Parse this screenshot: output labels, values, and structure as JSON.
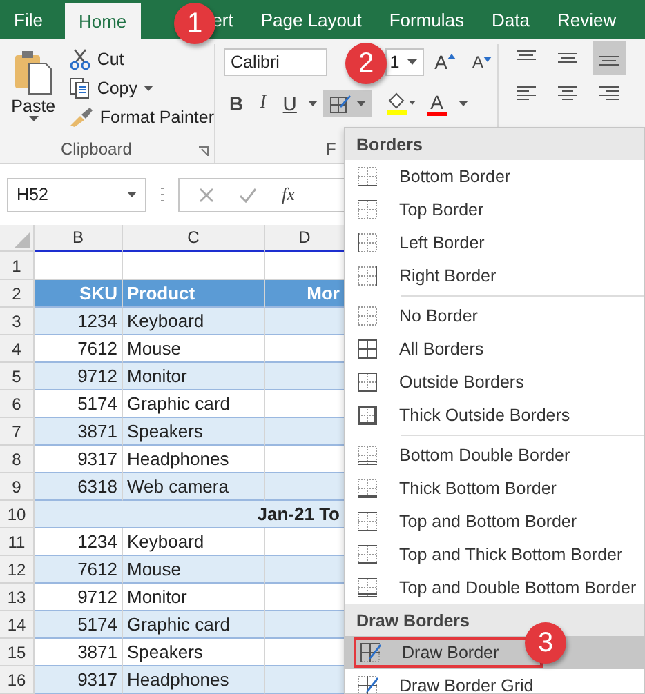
{
  "tabs": [
    {
      "label": "File",
      "selected": false
    },
    {
      "label": "Home",
      "selected": true
    },
    {
      "label": "ert",
      "selected": false
    },
    {
      "label": "Page Layout",
      "selected": false
    },
    {
      "label": "Formulas",
      "selected": false
    },
    {
      "label": "Data",
      "selected": false
    },
    {
      "label": "Review",
      "selected": false
    }
  ],
  "clipboard": {
    "paste": "Paste",
    "cut": "Cut",
    "copy": "Copy",
    "format_painter": "Format Painter",
    "group_label": "Clipboard"
  },
  "font": {
    "font_name": "Calibri",
    "font_size": "1",
    "grow": "A",
    "shrink": "A",
    "bold": "B",
    "italic": "I",
    "underline": "U",
    "font_color_letter": "A",
    "group_label": "F",
    "border_button_pressed": true
  },
  "formula_bar": {
    "name_box": "H52",
    "function_label": "fx"
  },
  "sheet": {
    "columns": [
      "B",
      "C",
      "D"
    ],
    "rows": [
      {
        "number": "1",
        "kind": "empty"
      },
      {
        "number": "2",
        "kind": "header",
        "cells": [
          "SKU",
          "Product",
          "Mor"
        ]
      },
      {
        "number": "3",
        "kind": "band",
        "cells": [
          "1234",
          "Keyboard"
        ]
      },
      {
        "number": "4",
        "kind": "plain",
        "cells": [
          "7612",
          "Mouse"
        ]
      },
      {
        "number": "5",
        "kind": "band",
        "cells": [
          "9712",
          "Monitor"
        ]
      },
      {
        "number": "6",
        "kind": "plain",
        "cells": [
          "5174",
          "Graphic card"
        ]
      },
      {
        "number": "7",
        "kind": "band",
        "cells": [
          "3871",
          "Speakers"
        ]
      },
      {
        "number": "8",
        "kind": "plain",
        "cells": [
          "9317",
          "Headphones"
        ]
      },
      {
        "number": "9",
        "kind": "band",
        "cells": [
          "6318",
          "Web camera"
        ]
      },
      {
        "number": "10",
        "kind": "total",
        "cells": [
          "Jan-21 To"
        ]
      },
      {
        "number": "11",
        "kind": "plain",
        "cells": [
          "1234",
          "Keyboard"
        ]
      },
      {
        "number": "12",
        "kind": "band",
        "cells": [
          "7612",
          "Mouse"
        ]
      },
      {
        "number": "13",
        "kind": "plain",
        "cells": [
          "9712",
          "Monitor"
        ]
      },
      {
        "number": "14",
        "kind": "band",
        "cells": [
          "5174",
          "Graphic card"
        ]
      },
      {
        "number": "15",
        "kind": "plain",
        "cells": [
          "3871",
          "Speakers"
        ]
      },
      {
        "number": "16",
        "kind": "band",
        "cells": [
          "9317",
          "Headphones"
        ]
      }
    ]
  },
  "menu": {
    "sections": [
      {
        "title": "Borders",
        "groups": [
          [
            {
              "label": "Bottom Border",
              "kind": "bottom",
              "selected": false
            },
            {
              "label": "Top Border",
              "kind": "top",
              "selected": false
            },
            {
              "label": "Left Border",
              "kind": "left",
              "selected": false
            },
            {
              "label": "Right Border",
              "kind": "right",
              "selected": false
            }
          ],
          [
            {
              "label": "No Border",
              "kind": "none",
              "selected": false
            },
            {
              "label": "All Borders",
              "kind": "all",
              "selected": false
            },
            {
              "label": "Outside Borders",
              "kind": "outside",
              "selected": false
            },
            {
              "label": "Thick Outside Borders",
              "kind": "thick_outside",
              "selected": false
            }
          ],
          [
            {
              "label": "Bottom Double Border",
              "kind": "bottom_double",
              "selected": false
            },
            {
              "label": "Thick Bottom Border",
              "kind": "thick_bottom",
              "selected": false
            },
            {
              "label": "Top and Bottom Border",
              "kind": "top_bottom",
              "selected": false
            },
            {
              "label": "Top and Thick Bottom Border",
              "kind": "top_thick_bottom",
              "selected": false
            },
            {
              "label": "Top and Double Bottom Border",
              "kind": "top_double_bottom",
              "selected": false
            }
          ]
        ]
      },
      {
        "title": "Draw Borders",
        "groups": [
          [
            {
              "label": "Draw Border",
              "kind": "draw",
              "selected": true
            },
            {
              "label": "Draw Border Grid",
              "kind": "draw_grid",
              "selected": false
            }
          ]
        ]
      }
    ]
  },
  "callouts": [
    "1",
    "2",
    "3"
  ]
}
